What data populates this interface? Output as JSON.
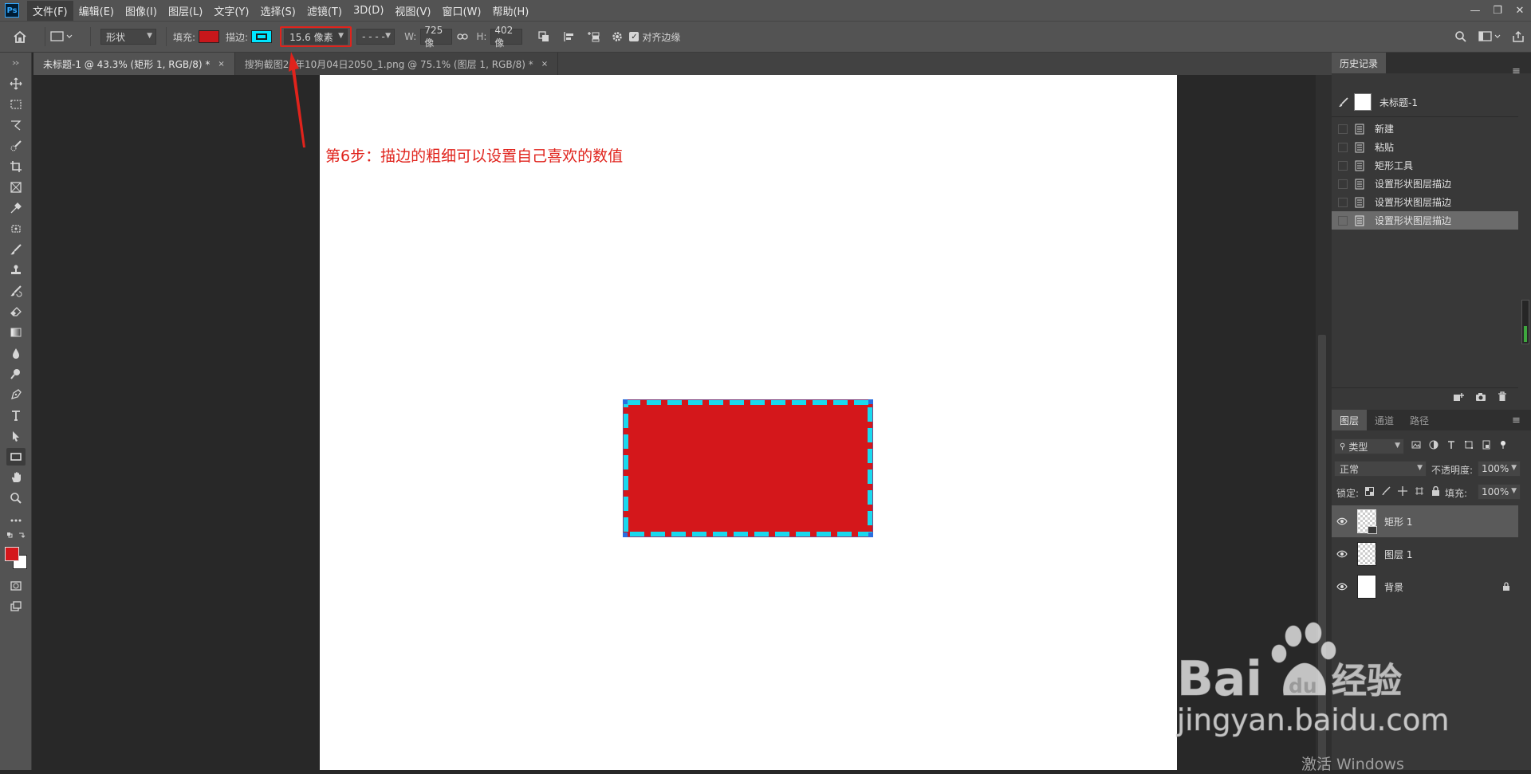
{
  "app": {
    "logo": "Ps"
  },
  "menubar": {
    "items": [
      "文件(F)",
      "编辑(E)",
      "图像(I)",
      "图层(L)",
      "文字(Y)",
      "选择(S)",
      "滤镜(T)",
      "3D(D)",
      "视图(V)",
      "窗口(W)",
      "帮助(H)"
    ]
  },
  "window_controls": {
    "minimize": "—",
    "restore": "❐",
    "close": "✕"
  },
  "options": {
    "shape_mode": "形状",
    "fill_label": "填充:",
    "fill_color": "#c8171b",
    "stroke_label": "描边:",
    "stroke_color": "#00e5ff",
    "stroke_width": "15.6 像素",
    "stroke_style": "- - - -",
    "w_label": "W:",
    "w_value": "725 像",
    "h_label": "H:",
    "h_value": "402 像",
    "align_edges_label": "对齐边缘",
    "align_edges_checked": true
  },
  "tabs": [
    {
      "label": "未标题-1 @ 43.3% (矩形 1, RGB/8) *",
      "close": "×",
      "active": true
    },
    {
      "label": "搜狗截图21年10月04日2050_1.png @ 75.1% (图层 1, RGB/8) *",
      "close": "×",
      "active": false
    }
  ],
  "colors": {
    "foreground": "#d4171b",
    "background": "#ffffff",
    "annotation": "#e0231c",
    "highlight_box": "#e0231c"
  },
  "annotation": {
    "text": "第6步：描边的粗细可以设置自己喜欢的数值"
  },
  "shape": {
    "fill": "#d4171b",
    "stroke": "#19d9ee"
  },
  "history_panel": {
    "tab": "历史记录",
    "snapshot": "未标题-1",
    "items": [
      {
        "label": "新建",
        "active": false
      },
      {
        "label": "粘贴",
        "active": false
      },
      {
        "label": "矩形工具",
        "active": false
      },
      {
        "label": "设置形状图层描边",
        "active": false
      },
      {
        "label": "设置形状图层描边",
        "active": false
      },
      {
        "label": "设置形状图层描边",
        "active": true
      }
    ]
  },
  "layers_panel": {
    "tabs": [
      "图层",
      "通道",
      "路径"
    ],
    "filter_type": "类型",
    "blend_mode": "正常",
    "opacity_label": "不透明度:",
    "opacity": "100%",
    "lock_label": "锁定:",
    "fill_label": "填充:",
    "fill": "100%",
    "layers": [
      {
        "name": "矩形 1",
        "active": true
      },
      {
        "name": "图层 1",
        "active": false
      },
      {
        "name": "背景",
        "active": false,
        "locked": true
      }
    ]
  },
  "watermark": {
    "brand_left": "Bai",
    "brand_paw": "du",
    "brand_cn": "经验",
    "url": "jingyan.baidu.com"
  },
  "system": {
    "activate_windows": "激活 Windows"
  }
}
